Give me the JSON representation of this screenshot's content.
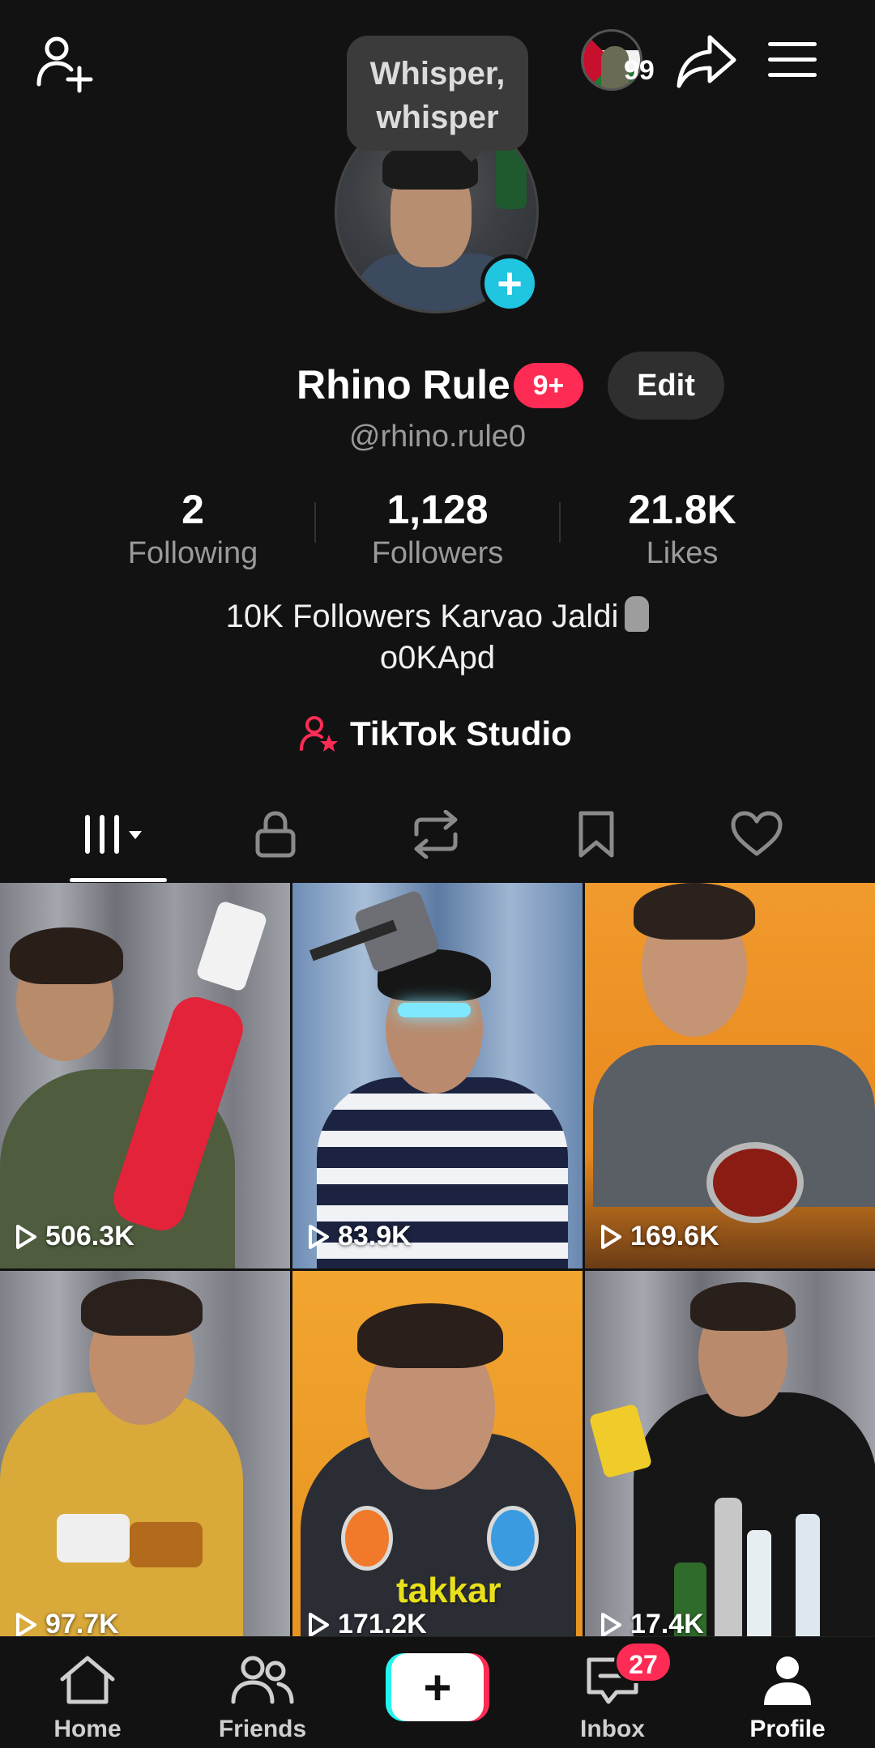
{
  "tooltip": {
    "text_line1": "Whisper,",
    "text_line2": "whisper"
  },
  "story": {
    "count": "99"
  },
  "profile": {
    "name": "Rhino Rule",
    "name_badge": "9+",
    "edit_label": "Edit",
    "handle": "@rhino.rule0",
    "stats": [
      {
        "value": "2",
        "label": "Following"
      },
      {
        "value": "1,128",
        "label": "Followers"
      },
      {
        "value": "21.8K",
        "label": "Likes"
      }
    ],
    "bio_line1": "10K Followers Karvao Jaldi",
    "bio_line2": "o0KApd",
    "studio_label": "TikTok Studio"
  },
  "tabs": [
    {
      "icon": "grid-icon",
      "active": true
    },
    {
      "icon": "lock-icon"
    },
    {
      "icon": "repost-icon"
    },
    {
      "icon": "bookmark-icon"
    },
    {
      "icon": "heart-icon"
    }
  ],
  "videos": [
    {
      "views": "506.3K"
    },
    {
      "views": "83.9K"
    },
    {
      "views": "169.6K"
    },
    {
      "views": "97.7K"
    },
    {
      "views": "171.2K",
      "overlay_text": "takkar"
    },
    {
      "views": "17.4K"
    }
  ],
  "nav": {
    "home": "Home",
    "friends": "Friends",
    "inbox": "Inbox",
    "inbox_badge": "27",
    "profile": "Profile"
  },
  "colors": {
    "accent_red": "#fe2c55",
    "accent_cyan": "#25f4ee",
    "avatar_plus": "#20c5e0",
    "background": "#121212"
  }
}
